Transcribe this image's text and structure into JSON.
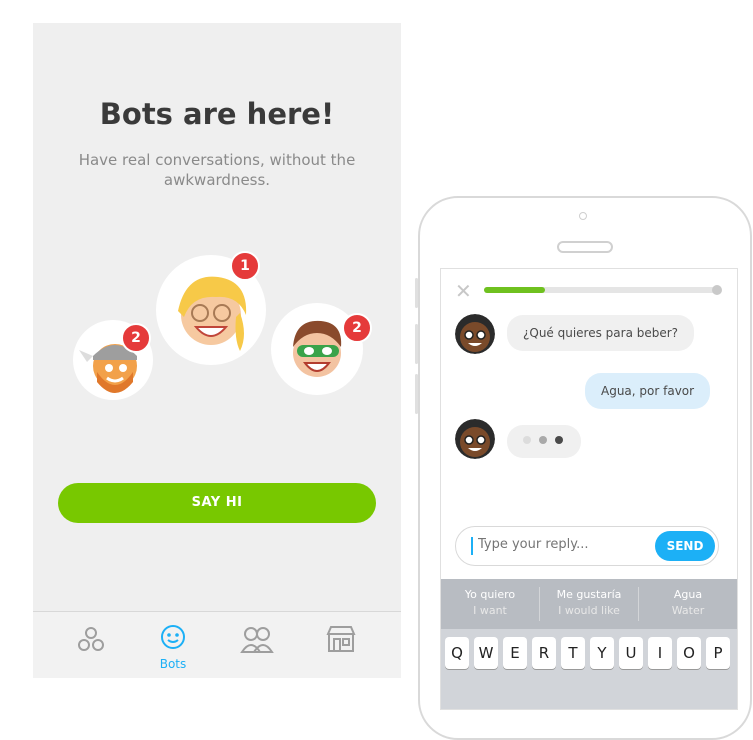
{
  "onboarding": {
    "title": "Bots are here!",
    "subtitle": "Have real conversations, without the awkwardness.",
    "cta_label": "SAY HI",
    "bots": [
      {
        "name": "viking-bot",
        "badge": "2"
      },
      {
        "name": "blonde-bot",
        "badge": "1"
      },
      {
        "name": "superhero-bot",
        "badge": "2"
      }
    ],
    "tabs": [
      {
        "icon": "learn-icon",
        "label": ""
      },
      {
        "icon": "bot-icon",
        "label": "Bots"
      },
      {
        "icon": "clubs-icon",
        "label": ""
      },
      {
        "icon": "shop-icon",
        "label": ""
      }
    ]
  },
  "chat": {
    "progress": 0.26,
    "messages": [
      {
        "from": "bot",
        "text": "¿Qué quieres para beber?"
      },
      {
        "from": "user",
        "text": "Agua, por favor"
      }
    ],
    "reply_placeholder": "Type your reply...",
    "send_label": "SEND",
    "suggestions": [
      {
        "main": "Yo quiero",
        "sub": "I want"
      },
      {
        "main": "Me gustaría",
        "sub": "I would like"
      },
      {
        "main": "Agua",
        "sub": "Water"
      }
    ],
    "keys": [
      "Q",
      "W",
      "E",
      "R",
      "T",
      "Y",
      "U",
      "I",
      "O",
      "P"
    ]
  },
  "colors": {
    "accent_green": "#78c800",
    "accent_blue": "#1cb0f6",
    "badge_red": "#e53a3a"
  }
}
